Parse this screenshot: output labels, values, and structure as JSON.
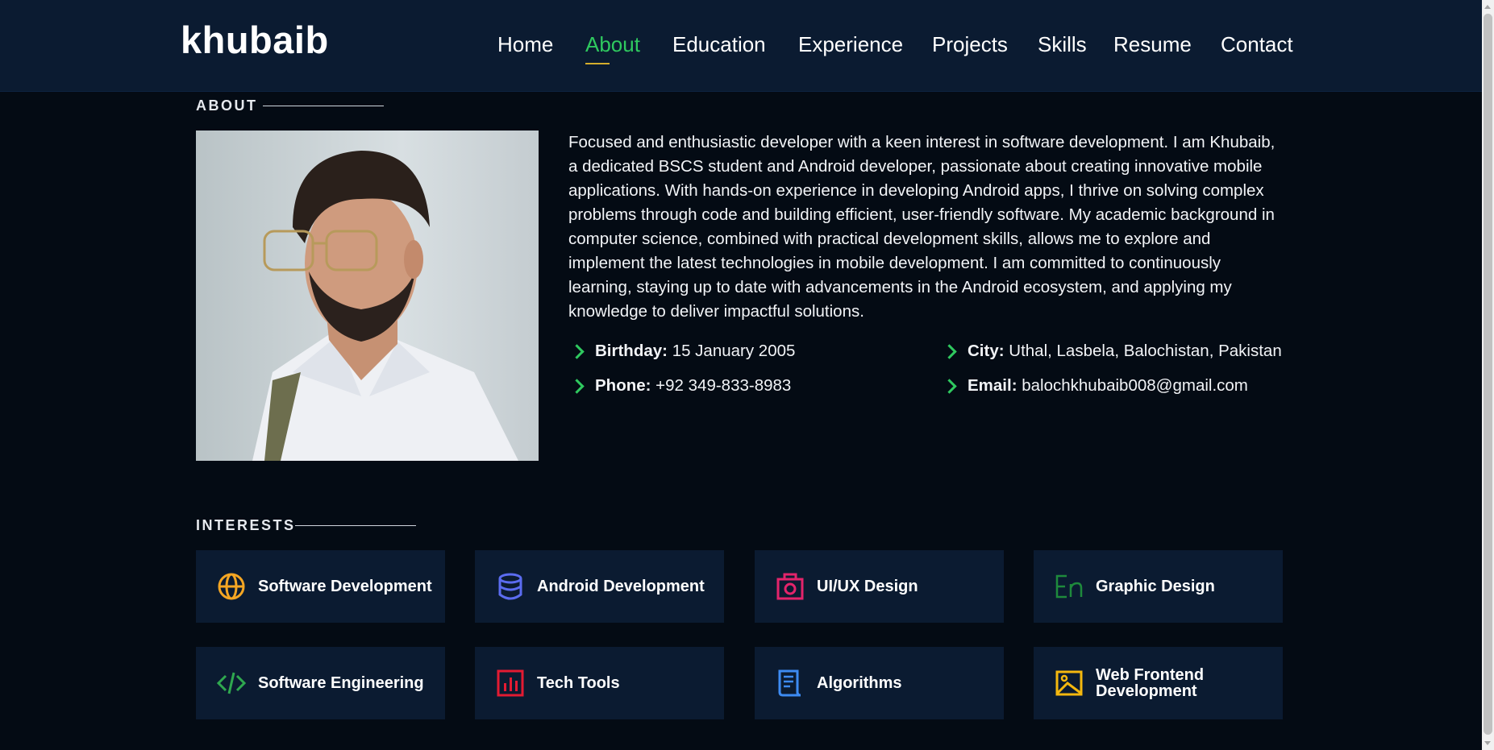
{
  "brand": {
    "logo_text": "khubaib"
  },
  "nav": {
    "items": [
      {
        "label": "Home"
      },
      {
        "label": "About",
        "active": true
      },
      {
        "label": "Education"
      },
      {
        "label": "Experience"
      },
      {
        "label": "Projects"
      },
      {
        "label": "Skills"
      },
      {
        "label": "Resume"
      },
      {
        "label": "Contact"
      }
    ]
  },
  "about": {
    "section_title": "ABOUT",
    "bio": "Focused and enthusiastic developer with a keen interest in software development. I am Khubaib, a dedicated BSCS student and Android developer, passionate about creating innovative mobile applications. With hands-on experience in developing Android apps, I thrive on solving complex problems through code and building efficient, user-friendly software. My academic background in computer science, combined with practical development skills, allows me to explore and implement the latest technologies in mobile development. I am committed to continuously learning, staying up to date with advancements in the Android ecosystem, and applying my knowledge to deliver impactful solutions.",
    "details": {
      "birthday_label": "Birthday:",
      "birthday_value": "15 January 2005",
      "city_label": "City:",
      "city_value": "Uthal, Lasbela, Balochistan, Pakistan",
      "phone_label": "Phone:",
      "phone_value": "+92 349-833-8983",
      "email_label": "Email:",
      "email_value": "balochkhubaib008@gmail.com"
    }
  },
  "interests": {
    "section_title": "INTERESTS",
    "items": [
      {
        "label": "Software Development",
        "icon": "globe-icon",
        "color": "#f5a623"
      },
      {
        "label": "Android Development",
        "icon": "database-icon",
        "color": "#5b6cf0"
      },
      {
        "label": "UI/UX Design",
        "icon": "camera-icon",
        "color": "#e3246b"
      },
      {
        "label": "Graphic Design",
        "icon": "en-icon",
        "color": "#1e8a3c"
      },
      {
        "label": "Software Engineering",
        "icon": "code-icon",
        "color": "#2fa84f"
      },
      {
        "label": "Tech Tools",
        "icon": "bar-chart-icon",
        "color": "#e31b32"
      },
      {
        "label": "Algorithms",
        "icon": "document-icon",
        "color": "#3d8bf2"
      },
      {
        "label": "Web Frontend Development",
        "icon": "image-icon",
        "color": "#f5b80e"
      }
    ]
  }
}
